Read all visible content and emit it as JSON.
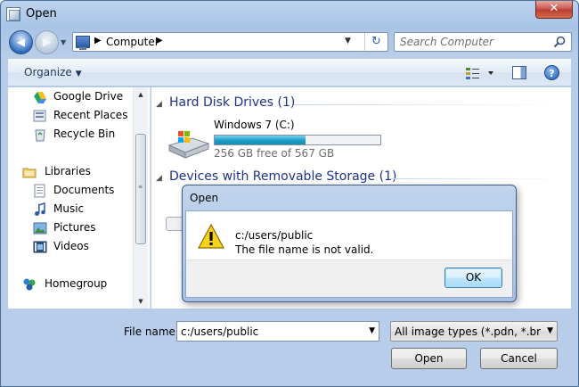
{
  "window": {
    "title": "Open",
    "close_glyph": "✕"
  },
  "navigation": {
    "back_glyph": "◀",
    "forward_glyph": "▶"
  },
  "address": {
    "crumb": "Computer",
    "refresh_glyph": "↻"
  },
  "search": {
    "placeholder": "Search Computer"
  },
  "toolbar": {
    "organize_label": "Organize",
    "help_glyph": "?"
  },
  "nav_pane": {
    "favorites": [
      {
        "label": "Google Drive",
        "icon": "google-drive-icon"
      },
      {
        "label": "Recent Places",
        "icon": "recent-places-icon"
      },
      {
        "label": "Recycle Bin",
        "icon": "recycle-bin-icon"
      }
    ],
    "libraries": {
      "label": "Libraries",
      "items": [
        {
          "label": "Documents",
          "icon": "documents-icon"
        },
        {
          "label": "Music",
          "icon": "music-icon"
        },
        {
          "label": "Pictures",
          "icon": "pictures-icon"
        },
        {
          "label": "Videos",
          "icon": "videos-icon"
        }
      ]
    },
    "homegroup": {
      "label": "Homegroup",
      "icon": "homegroup-icon"
    }
  },
  "content": {
    "groups": [
      {
        "title": "Hard Disk Drives (1)"
      },
      {
        "title": "Devices with Removable Storage (1)"
      }
    ],
    "drive": {
      "name": "Windows 7 (C:)",
      "free_text": "256 GB free of 567 GB",
      "used_fraction": 0.55
    }
  },
  "footer": {
    "file_name_label": "File name:",
    "file_name_value": "c:/users/public",
    "file_type": "All image types (*.pdn, *.bmp, *",
    "open_label": "Open",
    "cancel_label": "Cancel"
  },
  "error_dialog": {
    "title": "Open",
    "line1": "c:/users/public",
    "line2": "The file name is not valid.",
    "ok_label": "OK"
  },
  "colors": {
    "group_title": "#1e3287",
    "drive_bar": "#1b9cc6",
    "titlebar": "#bcd3ee"
  }
}
